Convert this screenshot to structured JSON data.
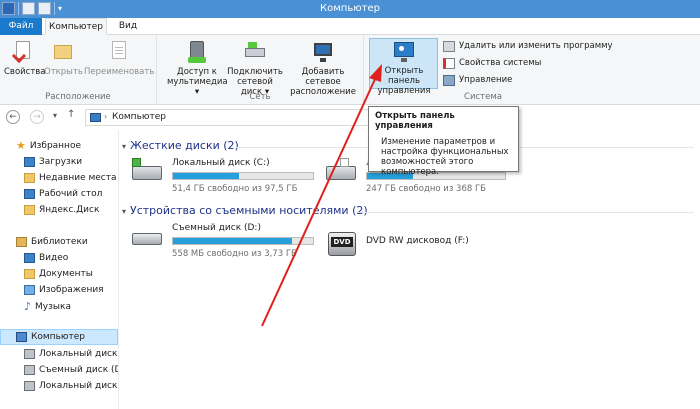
{
  "window": {
    "title": "Компьютер"
  },
  "tabs": {
    "file": "Файл",
    "computer": "Компьютер",
    "view": "Вид"
  },
  "ribbon": {
    "location": {
      "label": "Расположение",
      "properties": "Свойства",
      "open": "Открыть",
      "rename": "Переименовать"
    },
    "network": {
      "label": "Сеть",
      "media_line1": "Доступ к",
      "media_line2": "мультимедиа ▾",
      "map_line1": "Подключить",
      "map_line2": "сетевой диск ▾",
      "add_line1": "Добавить сетевое",
      "add_line2": "расположение"
    },
    "system": {
      "label": "Система",
      "cp_line1": "Открыть панель",
      "cp_line2": "управления",
      "uninstall": "Удалить или изменить программу",
      "sysprops": "Свойства системы",
      "manage": "Управление"
    }
  },
  "address": {
    "crumb": "Компьютер"
  },
  "tooltip": {
    "title": "Открыть панель управления",
    "line1": "Изменение параметров и",
    "line2": "настройка функциональных",
    "line3": "возможностей этого",
    "line4": "компьютера."
  },
  "navpane": {
    "favorites": "Избранное",
    "downloads": "Загрузки",
    "recent": "Недавние места",
    "desktop": "Рабочий стол",
    "yadisk": "Яндекс.Диск",
    "libraries": "Библиотеки",
    "video": "Видео",
    "documents": "Документы",
    "images": "Изображения",
    "music": "Музыка",
    "computer": "Компьютер",
    "drive_c": "Локальный диск (C",
    "drive_d": "Съемный диск (D:)",
    "drive_e": "Локальный диск (E"
  },
  "content": {
    "hdd_header": "Жесткие диски (2)",
    "removable_header": "Устройства со съемными носителями (2)",
    "drive_c": {
      "name": "Локальный диск (C:)",
      "free": "51,4 ГБ свободно из 97,5 ГБ",
      "used": 0.47
    },
    "drive_e": {
      "name": "Л",
      "free": "247 ГБ свободно из 368 ГБ",
      "used": 0.33
    },
    "drive_d": {
      "name": "Съемный диск (D:)",
      "free": "558 МБ свободно из 3,73 ГБ",
      "used": 0.85
    },
    "drive_f": {
      "name": "DVD RW дисковод (F:)",
      "icon_label": "DVD"
    }
  },
  "colors": {
    "accent": "#1979ca",
    "bar": "#26a0da",
    "header": "#1e3287",
    "arrow": "#e0201c"
  }
}
